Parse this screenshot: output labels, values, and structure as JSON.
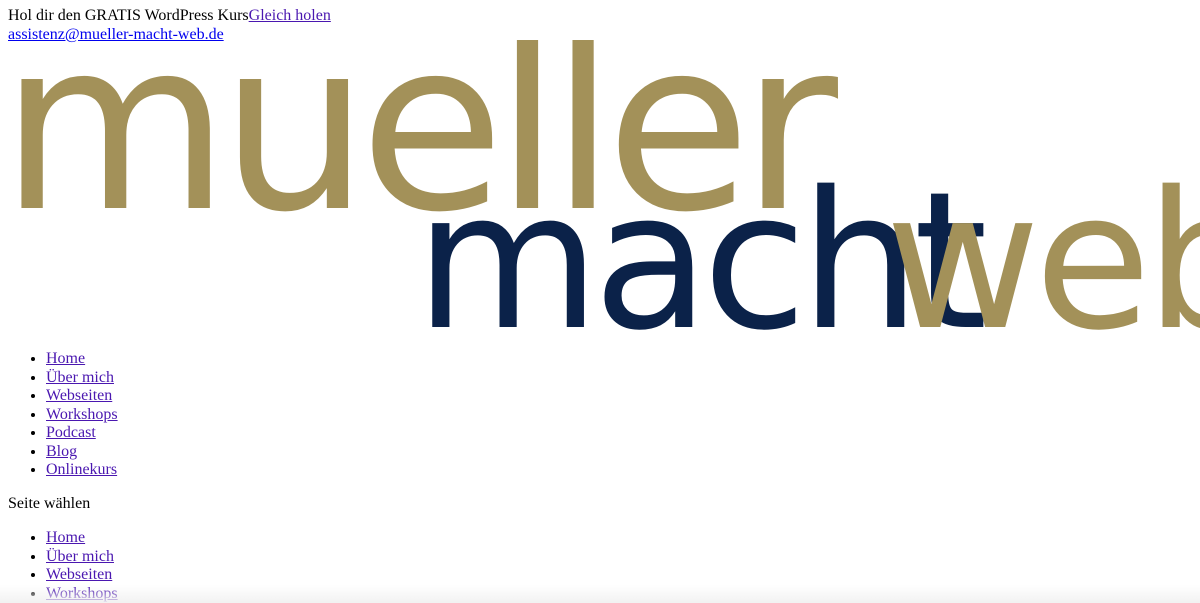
{
  "topbar": {
    "promo_text": "Hol dir den GRATIS WordPress Kurs",
    "promo_link": "Gleich holen",
    "email": "assistenz@mueller-macht-web.de"
  },
  "logo": {
    "word_mueller": "mueller",
    "word_macht": "macht",
    "word_web": "web",
    "colors": {
      "gold": "#a39159",
      "navy": "#0b2249"
    }
  },
  "nav_main": {
    "items": [
      {
        "label": "Home"
      },
      {
        "label": "Über mich"
      },
      {
        "label": "Webseiten"
      },
      {
        "label": "Workshops"
      },
      {
        "label": "Podcast"
      },
      {
        "label": "Blog"
      },
      {
        "label": "Onlinekurs"
      }
    ]
  },
  "select_page": {
    "label": "Seite wählen"
  },
  "nav_mobile": {
    "items": [
      {
        "label": "Home"
      },
      {
        "label": "Über mich"
      },
      {
        "label": "Webseiten"
      },
      {
        "label": "Workshops"
      }
    ]
  }
}
